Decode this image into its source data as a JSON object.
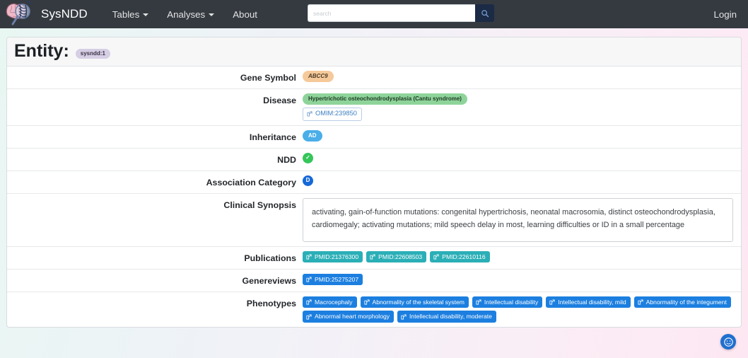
{
  "navbar": {
    "brand": "SysNDD",
    "logo_icon": "brain-dna-magnifier-logo",
    "items": [
      {
        "label": "Tables",
        "has_caret": true,
        "name": "nav-item-tables"
      },
      {
        "label": "Analyses",
        "has_caret": true,
        "name": "nav-item-analyses"
      },
      {
        "label": "About",
        "has_caret": false,
        "name": "nav-item-about"
      }
    ],
    "search": {
      "value": "",
      "placeholder": "search",
      "icon": "search-icon"
    },
    "login_label": "Login",
    "background_color": "#343a40"
  },
  "entity": {
    "title": "Entity:",
    "id_badge": "sysndd:1",
    "id_badge_color": "#d6cee4"
  },
  "rows": {
    "gene_symbol": {
      "label": "Gene Symbol",
      "value": "ABCC9",
      "color": "#f5c99a"
    },
    "disease": {
      "label": "Disease",
      "name_badge": "Hypertrichotic osteochondrodysplasia (Cantu syndrome)",
      "name_badge_color": "#8ed49a",
      "link": "OMIM:239850",
      "link_icon": "external-link-icon"
    },
    "inheritance": {
      "label": "Inheritance",
      "value": "AD",
      "color": "#4aaee8"
    },
    "ndd": {
      "label": "NDD",
      "icon": "check-circle-icon",
      "glyph": "✓",
      "color": "#35c659"
    },
    "association_category": {
      "label": "Association Category",
      "icon": "definitive-circle-icon",
      "glyph": "D",
      "color": "#1668d8"
    },
    "clinical_synopsis": {
      "label": "Clinical Synopsis",
      "text": "activating, gain-of-function mutations: congenital hypertrichosis, neonatal macrosomia, distinct osteochondrodysplasia, cardiomegaly; activating mutations; mild speech delay in most, learning difficulties or ID in a small percentage"
    },
    "publications": {
      "label": "Publications",
      "color": "#2bafb7",
      "items": [
        "PMID:21376300",
        "PMID:22608503",
        "PMID:22610116"
      ]
    },
    "genereviews": {
      "label": "Genereviews",
      "color": "#1c7fe0",
      "items": [
        "PMID:25275207"
      ]
    },
    "phenotypes": {
      "label": "Phenotypes",
      "color": "#1c7fe0",
      "items": [
        "Macrocephaly",
        "Abnormality of the skeletal system",
        "Intellectual disability",
        "Intellectual disability, mild",
        "Abnormality of the integument",
        "Abnormal heart morphology",
        "Intellectual disability, moderate"
      ]
    }
  },
  "feedback": {
    "icon": "smiley-feedback-icon",
    "color": "#1f6fd0"
  }
}
